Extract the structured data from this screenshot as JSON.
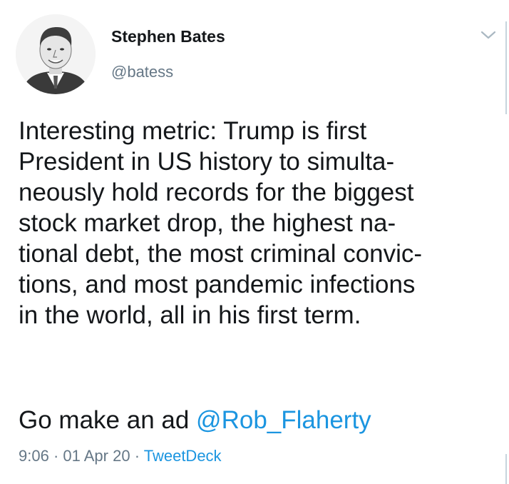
{
  "author": {
    "name": "Stephen Bates",
    "handle": "@batess"
  },
  "tweet": {
    "lines": [
      "Interesting metric: Trump is first",
      "President in US history to simulta-",
      "neously hold records for the biggest",
      "stock market drop, the highest na-",
      "tional debt, the most criminal convic-",
      "tions, and most pandemic infections",
      "in the world, all in his first term."
    ],
    "second_paragraph_text": "Go make an ad ",
    "mention": "@Rob_Flaherty"
  },
  "meta": {
    "time": "9:06",
    "sep1": " · ",
    "date": "01 Apr 20",
    "sep2": " · ",
    "source": "TweetDeck"
  },
  "icons": {
    "menu": "chevron-down-icon",
    "avatar": "avatar"
  },
  "colors": {
    "text": "#14171a",
    "secondary": "#657786",
    "link": "#1b95e0"
  }
}
